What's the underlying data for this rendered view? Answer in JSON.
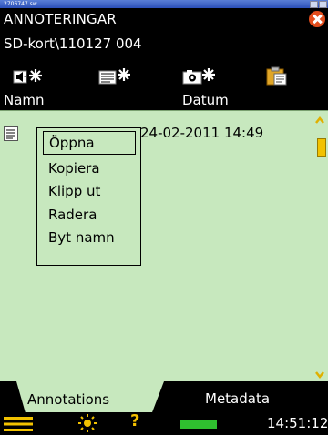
{
  "window": {
    "caption": "2706747 sw"
  },
  "header": {
    "title": "ANNOTERINGAR",
    "path": "SD-kort\\110127 004"
  },
  "toolbar": {
    "items": [
      {
        "name": "new-audio-note-icon"
      },
      {
        "name": "new-text-note-icon"
      },
      {
        "name": "new-photo-icon"
      },
      {
        "name": "paste-icon"
      }
    ]
  },
  "columns": {
    "name": "Namn",
    "date": "Datum"
  },
  "rows": [
    {
      "date": "24-02-2011 14:49"
    }
  ],
  "context_menu": {
    "items": [
      "Öppna",
      "Kopiera",
      "Klipp ut",
      "Radera",
      "Byt namn"
    ],
    "selected_index": 0
  },
  "tabs": {
    "annotations": "Annotations",
    "metadata": "Metadata"
  },
  "status": {
    "help": "?",
    "time": "14:51:12",
    "battery_level": 1
  },
  "colors": {
    "background": "#000000",
    "list_bg": "#c7e8be",
    "accent_yellow": "#f2c200",
    "close_red": "#e24d1d",
    "battery_green": "#2fbf2f"
  }
}
